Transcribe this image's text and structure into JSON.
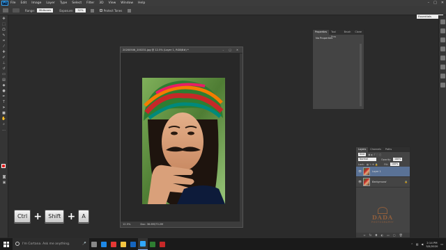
{
  "menubar": {
    "logo": "Ps",
    "items": [
      "File",
      "Edit",
      "Image",
      "Layer",
      "Type",
      "Select",
      "Filter",
      "3D",
      "View",
      "Window",
      "Help"
    ],
    "window_controls": [
      "–",
      "□",
      "✕"
    ]
  },
  "options_bar": {
    "range_label": "Range:",
    "range_value": "Midtones",
    "exposure_label": "Exposure:",
    "exposure_value": "32%",
    "protect_tones": "Protect Tones",
    "workspace": "Essentials"
  },
  "document": {
    "title": "20200506_200231.jpg @ 12.5% (Layer 1, RGB/8#) *",
    "zoom": "12.5%",
    "doc_size": "Doc: 36.6M/73.2M",
    "title_controls": "– □ ✕"
  },
  "properties_panel": {
    "tabs": [
      "Properties",
      "Tool Pres",
      "Brush",
      "Clone"
    ],
    "body": "No Properties"
  },
  "layers_panel": {
    "tabs": [
      "Layers",
      "Channels",
      "Paths"
    ],
    "kind_label": "Kind",
    "blend_mode": "Normal",
    "opacity_label": "Opacity:",
    "opacity_value": "100%",
    "lock_label": "Lock:",
    "fill_label": "Fill:",
    "fill_value": "100%",
    "layers": [
      {
        "name": "Layer 1",
        "active": true
      },
      {
        "name": "Background",
        "active": false
      }
    ],
    "watermark_big": "DADA",
    "watermark_small": "PHOTOGRAPHY",
    "footer_icons": [
      "link-icon",
      "fx-icon",
      "mask-icon",
      "adjust-icon",
      "folder-icon",
      "new-layer-icon",
      "trash-icon"
    ]
  },
  "shortcut_overlay": {
    "keys": [
      "Ctrl",
      "Shift",
      "A"
    ],
    "separator": "+"
  },
  "taskbar": {
    "search_placeholder": "I'm Cortana. Ask me anything.",
    "time": "2:14 PM",
    "date": "5/5/2020",
    "apps": [
      {
        "name": "task-view-icon",
        "color": "#888"
      },
      {
        "name": "edge-icon",
        "color": "#1e88e5"
      },
      {
        "name": "chrome-icon",
        "color": "#e53935"
      },
      {
        "name": "explorer-icon",
        "color": "#f4c542"
      },
      {
        "name": "store-icon",
        "color": "#1565c0"
      },
      {
        "name": "photoshop-icon",
        "color": "#31a8ff"
      },
      {
        "name": "excel-icon",
        "color": "#2e7d32"
      },
      {
        "name": "app-icon",
        "color": "#c62828"
      }
    ]
  }
}
